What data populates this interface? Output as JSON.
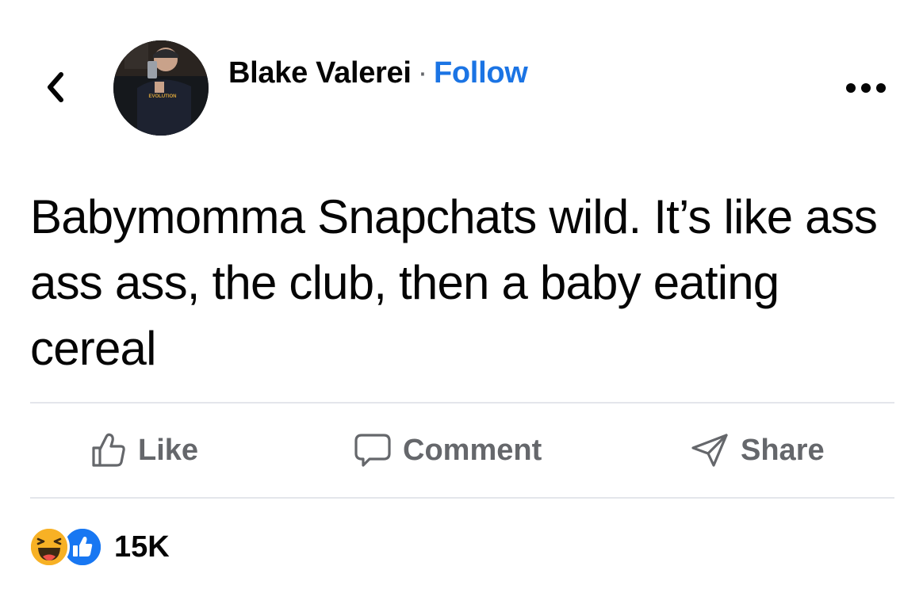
{
  "post": {
    "author_name": "Blake Valerei",
    "separator": "·",
    "follow_label": "Follow",
    "text": "Babymomma Snapchats wild. It’s like ass ass ass, the club, then a baby eating cereal"
  },
  "actions": {
    "like_label": "Like",
    "comment_label": "Comment",
    "share_label": "Share"
  },
  "reactions": {
    "types": [
      "haha-icon",
      "like-icon"
    ],
    "count": "15K"
  },
  "colors": {
    "link": "#1b74e4",
    "secondary_text": "#65676b",
    "divider": "#e4e6eb",
    "like_blue": "#1877f2",
    "haha_yellow": "#f7b125"
  },
  "avatar": {
    "shirt_text": "EVOLUTION"
  }
}
